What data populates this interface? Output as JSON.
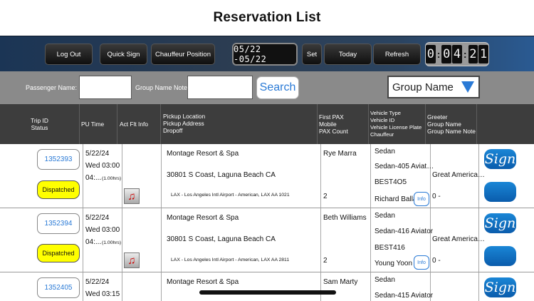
{
  "title": "Reservation List",
  "toolbar": {
    "logout": "Log Out",
    "quick_sign": "Quick Sign",
    "chauffeur_position": "Chauffeur Position",
    "date_range": "05/22 -05/22",
    "set": "Set",
    "today": "Today",
    "refresh": "Refresh",
    "timer": {
      "d1": "0",
      "d2": "0",
      "d3": "4",
      "d4": "2",
      "d5": "1"
    }
  },
  "filters": {
    "passenger_label": "Passenger Name:",
    "group_label": "Group Name Note:",
    "passenger_value": "",
    "group_value": "",
    "search": "Search",
    "group_select": "Group Name"
  },
  "columns": {
    "trip": [
      "Trip ID",
      "Status"
    ],
    "pu_time": [
      "PU Time"
    ],
    "act_flt": [
      "Act Flt Info"
    ],
    "pickup": [
      "Pickup Location",
      "Pickup Address",
      "Dropoff"
    ],
    "pax": [
      "First PAX",
      "Mobile",
      "PAX Count"
    ],
    "vehicle": [
      "Vehicle Type",
      "Vehicle ID",
      "Vehicle License Plate",
      "Chauffeur"
    ],
    "greeter": [
      "Greeter",
      "Group Name",
      "Group Name Note"
    ]
  },
  "rows": [
    {
      "trip_id": "1352393",
      "status": "Dispatched",
      "date": "5/22/24",
      "time": "Wed 03:00",
      "duration_prefix": "04:...",
      "duration": "(1.00hrs)",
      "pickup_location": "Montage Resort & Spa",
      "pickup_address": "30801 S Coast, Laguna Beach  CA",
      "dropoff": "LAX - Los Angeles Intl Airport - American, LAX    AA 1021",
      "first_pax": "Rye Marra",
      "pax_count": "2",
      "vehicle_type": "Sedan",
      "vehicle_id": "Sedan-405 Aviat…",
      "plate": "BEST4O5",
      "chauffeur": "Richard Balla",
      "greeter": "Great America…",
      "group_note": "0 -",
      "info": "Info",
      "sign": "Sign"
    },
    {
      "trip_id": "1352394",
      "status": "Dispatched",
      "date": "5/22/24",
      "time": "Wed 03:00",
      "duration_prefix": "04:...",
      "duration": "(1.00hrs)",
      "pickup_location": "Montage Resort & Spa",
      "pickup_address": "30801 S Coast, Laguna Beach  CA",
      "dropoff": "LAX - Los Angeles Intl Airport - American, LAX    AA 2811",
      "first_pax": "Beth Williams",
      "pax_count": "2",
      "vehicle_type": "Sedan",
      "vehicle_id": "Sedan-416 Aviator",
      "plate": "BEST416",
      "chauffeur": "Young Yoon",
      "greeter": "Great America…",
      "group_note": "0 -",
      "info": "Info",
      "sign": "Sign"
    },
    {
      "trip_id": "1352405",
      "date": "5/22/24",
      "time": "Wed 03:15",
      "pickup_location": "Montage Resort & Spa",
      "first_pax": "Sam Marty",
      "vehicle_type": "Sedan",
      "vehicle_id": "Sedan-415 Aviator",
      "sign": "Sign"
    }
  ],
  "colors": {
    "accent": "#2a7ad6",
    "status_dispatched": "#ffff00",
    "header_bg": "#3d3d3d",
    "filter_bg": "#8a8a8a"
  }
}
